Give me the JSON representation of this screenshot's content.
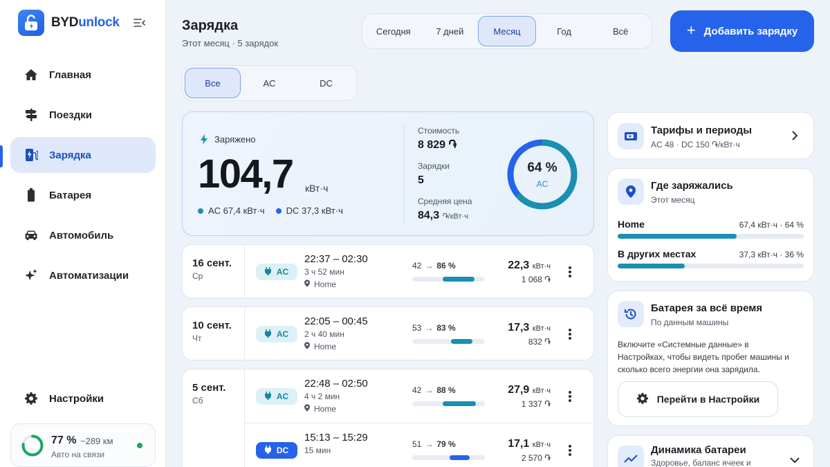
{
  "brand": {
    "name_a": "BYD",
    "name_b": "unlock"
  },
  "nav": [
    {
      "label": "Главная",
      "icon": "home-icon"
    },
    {
      "label": "Поездки",
      "icon": "signpost-icon"
    },
    {
      "label": "Зарядка",
      "icon": "ev-station-icon",
      "active": true
    },
    {
      "label": "Батарея",
      "icon": "battery-icon"
    },
    {
      "label": "Автомобиль",
      "icon": "car-icon"
    },
    {
      "label": "Автоматизации",
      "icon": "sparkle-icon"
    }
  ],
  "settings_label": "Настройки",
  "status": {
    "pct": "77 %",
    "range": "~289 км",
    "sub": "Авто на связи",
    "level": 0.77
  },
  "header": {
    "title": "Зарядка",
    "subtitle": "Этот месяц · 5 зарядок"
  },
  "periods": [
    "Сегодня",
    "7 дней",
    "Месяц",
    "Год",
    "Всё"
  ],
  "period_selected": "Месяц",
  "add_label": "Добавить зарядку",
  "types": [
    "Все",
    "AC",
    "DC"
  ],
  "type_selected": "Все",
  "summary": {
    "label": "Заряжено",
    "value": "104,7",
    "unit": "кВт·ч",
    "ac": "AC 67,4 кВт·ч",
    "dc": "DC 37,3 кВт·ч",
    "cost_label": "Стоимость",
    "cost_value": "8 829 ֏",
    "count_label": "Зарядки",
    "count_value": "5",
    "avg_label": "Средняя цена",
    "avg_value": "84,3",
    "avg_unit": "֏/кВт·ч",
    "donut_pct": "64 %",
    "donut_label": "AC",
    "donut_fraction": 0.64
  },
  "sessions": [
    {
      "date": "16 сент.",
      "dow": "Ср",
      "rows": [
        {
          "type": "AC",
          "time": "22:37 – 02:30",
          "dur": "3 ч 52 мин",
          "loc": "Home",
          "from": "42",
          "to": "86 %",
          "from_frac": 0.42,
          "to_frac": 0.86,
          "kwh": "22,3",
          "kwh_unit": "кВт·ч",
          "cost": "1 068 ֏"
        }
      ]
    },
    {
      "date": "10 сент.",
      "dow": "Чт",
      "rows": [
        {
          "type": "AC",
          "time": "22:05 – 00:45",
          "dur": "2 ч 40 мин",
          "loc": "Home",
          "from": "53",
          "to": "83 %",
          "from_frac": 0.53,
          "to_frac": 0.83,
          "kwh": "17,3",
          "kwh_unit": "кВт·ч",
          "cost": "832 ֏"
        }
      ]
    },
    {
      "date": "5 сент.",
      "dow": "Сб",
      "rows": [
        {
          "type": "AC",
          "time": "22:48 – 02:50",
          "dur": "4 ч 2 мин",
          "loc": "Home",
          "from": "42",
          "to": "88 %",
          "from_frac": 0.42,
          "to_frac": 0.88,
          "kwh": "27,9",
          "kwh_unit": "кВт·ч",
          "cost": "1 337 ֏"
        },
        {
          "type": "DC",
          "time": "15:13 – 15:29",
          "dur": "15 мин",
          "loc": "",
          "from": "51",
          "to": "79 %",
          "from_frac": 0.51,
          "to_frac": 0.79,
          "kwh": "17,1",
          "kwh_unit": "кВт·ч",
          "cost": "2 570 ֏"
        }
      ]
    }
  ],
  "tariffs": {
    "title": "Тарифы и периоды",
    "sub": "AC 48 · DC 150 ֏/кВт·ч"
  },
  "where": {
    "title": "Где заряжались",
    "sub": "Этот месяц",
    "places": [
      {
        "name": "Home",
        "value": "67,4 кВт·ч · 64 %",
        "frac": 0.64
      },
      {
        "name": "В других местах",
        "value": "37,3 кВт·ч · 36 %",
        "frac": 0.36
      }
    ]
  },
  "battery_all": {
    "title": "Батарея за всё время",
    "sub": "По данным машины",
    "text": "Включите «Системные данные» в Настройках, чтобы видеть пробег машины и сколько всего энергии она зарядила.",
    "button": "Перейти в Настройки"
  },
  "dynamics": {
    "title": "Динамика батареи",
    "sub": "Здоровье, баланс ячеек и"
  },
  "colors": {
    "accent": "#2563eb",
    "ac": "#1990b0",
    "dc": "#2563eb",
    "online": "#1fa463"
  }
}
